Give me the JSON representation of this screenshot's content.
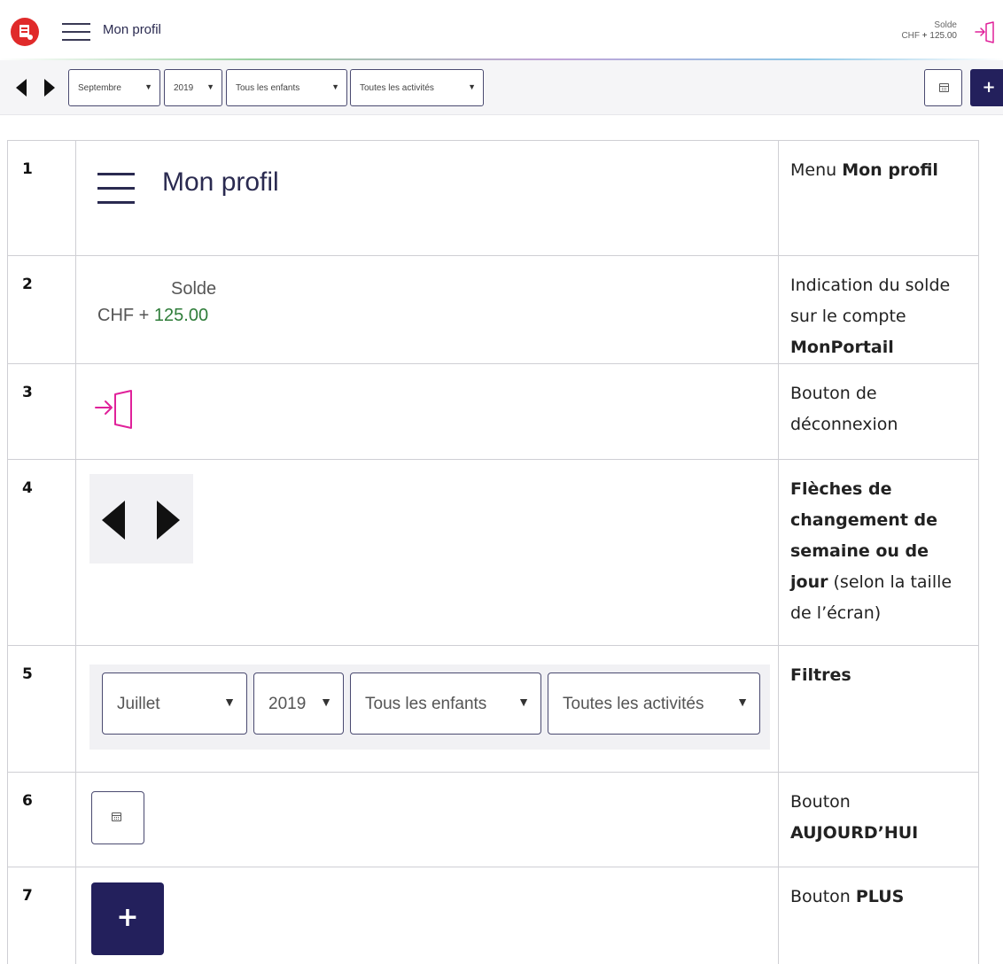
{
  "header": {
    "title": "Mon profil",
    "balance_label": "Solde",
    "balance_currency": "CHF",
    "balance_sign": "+",
    "balance_value": "125.00"
  },
  "toolbar": {
    "month": "Septembre",
    "year": "2019",
    "children": "Tous les enfants",
    "activities": "Toutes les activités",
    "caret": "▼",
    "plus_label": "+"
  },
  "table": {
    "rows": [
      {
        "num": "1",
        "illustration": {
          "title": "Mon profil"
        },
        "desc_plain": "Menu ",
        "desc_bold": "Mon profil"
      },
      {
        "num": "2",
        "illustration": {
          "label": "Solde",
          "currency": "CHF",
          "sign": "+",
          "value": "125.00"
        },
        "desc_plain": "Indication du solde sur le compte ",
        "desc_bold": "MonPortail"
      },
      {
        "num": "3",
        "desc_plain": "Bouton de déconnexion"
      },
      {
        "num": "4",
        "desc_bold": "Flèches de changement de semaine ou de jour",
        "desc_plain": " (selon la taille de l’écran)"
      },
      {
        "num": "5",
        "illustration": {
          "month": "Juillet",
          "year": "2019",
          "children": "Tous les enfants",
          "activities": "Toutes les activités"
        },
        "desc_bold": "Filtres"
      },
      {
        "num": "6",
        "desc_plain": "Bouton ",
        "desc_bold": "AUJOURD’HUI"
      },
      {
        "num": "7",
        "illustration": {
          "plus_label": "+"
        },
        "desc_plain": "Bouton ",
        "desc_bold": "PLUS"
      }
    ]
  },
  "colors": {
    "logo_red": "#e02a2a",
    "navy": "#23205c",
    "logout_pink": "#e0219a",
    "balance_green": "#2f7d3a"
  },
  "icons": {
    "logo": "document-logo-icon",
    "menu": "hamburger-icon",
    "logout": "logout-door-icon",
    "prev": "triangle-left-icon",
    "next": "triangle-right-icon",
    "today": "calendar-icon"
  }
}
